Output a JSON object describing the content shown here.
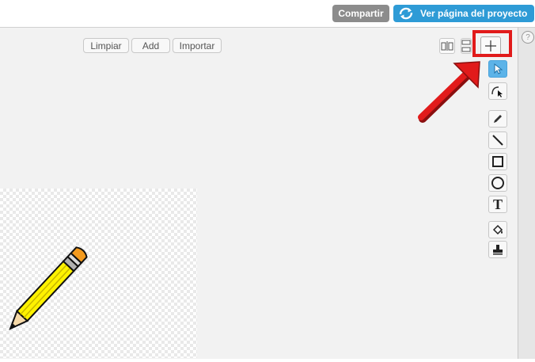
{
  "header": {
    "share_label": "Compartir",
    "view_project_label": "Ver página del proyecto"
  },
  "toolbar": {
    "clear_label": "Limpiar",
    "add_label": "Add",
    "import_label": "Importar"
  },
  "tools": [
    {
      "name": "select-tool",
      "selected": true
    },
    {
      "name": "reshape-tool",
      "selected": false
    },
    {
      "name": "pencil-tool",
      "selected": false
    },
    {
      "name": "line-tool",
      "selected": false
    },
    {
      "name": "rectangle-tool",
      "selected": false
    },
    {
      "name": "ellipse-tool",
      "selected": false
    },
    {
      "name": "text-tool",
      "selected": false
    },
    {
      "name": "fill-tool",
      "selected": false
    },
    {
      "name": "stamp-tool",
      "selected": false
    }
  ],
  "colors": {
    "accent_blue": "#2e9bd6",
    "share_gray": "#8c8c8c",
    "highlight_red": "#e11b1b",
    "selected_tool": "#5cb3e8"
  }
}
